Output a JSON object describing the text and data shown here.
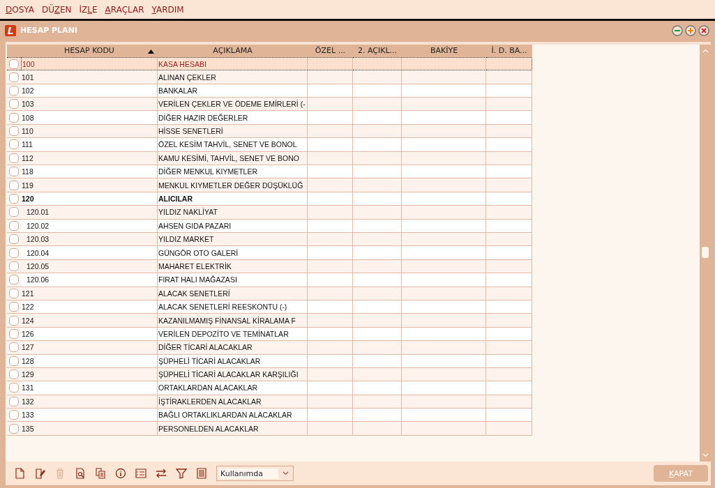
{
  "menu": [
    {
      "accel": "D",
      "after": "OSYA"
    },
    {
      "before": "DÜ",
      "accel": "Z",
      "after": "EN"
    },
    {
      "before": "İZ",
      "accel": "L",
      "after": "E"
    },
    {
      "accel": "A",
      "after": "RAÇLAR"
    },
    {
      "accel": "Y",
      "after": "ARDIM"
    }
  ],
  "window": {
    "title": "HESAP PLANI"
  },
  "table": {
    "columns": [
      {
        "label": "HESAP KODU",
        "sorted": true
      },
      {
        "label": "AÇIKLAMA",
        "sorted": false
      },
      {
        "label": "ÖZEL ...",
        "sorted": false
      },
      {
        "label": "2. AÇIKL...",
        "sorted": false
      },
      {
        "label": "BAKİYE",
        "sorted": false
      },
      {
        "label": "İ. D. BA...",
        "sorted": false
      }
    ],
    "rows": [
      {
        "code": "100",
        "description": "KASA HESABI",
        "kind": "account",
        "checked": false,
        "selected": true
      },
      {
        "code": "101",
        "description": "ALINAN ÇEKLER",
        "kind": "account",
        "checked": false,
        "selected": false
      },
      {
        "code": "102",
        "description": "BANKALAR",
        "kind": "account",
        "checked": false,
        "selected": false
      },
      {
        "code": "103",
        "description": "VERİLEN ÇEKLER VE ÖDEME EMİRLERİ (-",
        "kind": "account",
        "checked": false,
        "selected": false
      },
      {
        "code": "108",
        "description": "DİĞER HAZIR DEĞERLER",
        "kind": "account",
        "checked": false,
        "selected": false
      },
      {
        "code": "110",
        "description": "HİSSE SENETLERİ",
        "kind": "account",
        "checked": false,
        "selected": false
      },
      {
        "code": "111",
        "description": "ÖZEL KESİM TAHVİL, SENET VE BONOL",
        "kind": "account",
        "checked": false,
        "selected": false
      },
      {
        "code": "112",
        "description": "KAMU KESİMİ, TAHVİL, SENET VE BONO",
        "kind": "account",
        "checked": false,
        "selected": false
      },
      {
        "code": "118",
        "description": "DİĞER MENKUL KIYMETLER",
        "kind": "account",
        "checked": false,
        "selected": false
      },
      {
        "code": "119",
        "description": "MENKUL KIYMETLER DEĞER DÜŞÜKLÜĞ",
        "kind": "account",
        "checked": false,
        "selected": false
      },
      {
        "code": "120",
        "description": "ALICILAR",
        "kind": "group",
        "checked": false,
        "selected": false,
        "children": [
          {
            "code": "120.01",
            "description": "YILDIZ NAKLİYAT",
            "kind": "account",
            "checked": false,
            "selected": false
          },
          {
            "code": "120.02",
            "description": "AHSEN GIDA PAZARI",
            "kind": "account",
            "checked": false,
            "selected": false
          },
          {
            "code": "120.03",
            "description": "YILDIZ MARKET",
            "kind": "account",
            "checked": false,
            "selected": false
          },
          {
            "code": "120.04",
            "description": "GÜNGÖR OTO GALERİ",
            "kind": "account",
            "checked": false,
            "selected": false
          },
          {
            "code": "120.05",
            "description": "MAHARET ELEKTRİK",
            "kind": "account",
            "checked": false,
            "selected": false
          },
          {
            "code": "120.06",
            "description": "FIRAT HALI MAĞAZASI",
            "kind": "account",
            "checked": false,
            "selected": false
          }
        ]
      },
      {
        "code": "121",
        "description": "ALACAK SENETLERİ",
        "kind": "account",
        "checked": false,
        "selected": false
      },
      {
        "code": "122",
        "description": "ALACAK SENETLERİ REESKONTU (-)",
        "kind": "account",
        "checked": false,
        "selected": false
      },
      {
        "code": "124",
        "description": "KAZANILMAMIŞ FİNANSAL KİRALAMA F",
        "kind": "account",
        "checked": false,
        "selected": false
      },
      {
        "code": "126",
        "description": "VERİLEN DEPOZİTO VE TEMİNATLAR",
        "kind": "account",
        "checked": false,
        "selected": false
      },
      {
        "code": "127",
        "description": "DİĞER TİCARİ ALACAKLAR",
        "kind": "account",
        "checked": false,
        "selected": false
      },
      {
        "code": "128",
        "description": "ŞÜPHELİ TİCARİ ALACAKLAR",
        "kind": "account",
        "checked": false,
        "selected": false
      },
      {
        "code": "129",
        "description": "ŞÜPHELİ TİCARİ ALACAKLAR KARŞILIĞI",
        "kind": "account",
        "checked": false,
        "selected": false
      },
      {
        "code": "131",
        "description": "ORTAKLARDAN ALACAKLAR",
        "kind": "account",
        "checked": false,
        "selected": false
      },
      {
        "code": "132",
        "description": "İŞTİRAKLERDEN ALACAKLAR",
        "kind": "account",
        "checked": false,
        "selected": false
      },
      {
        "code": "133",
        "description": "BAĞLI ORTAKLIKLARDAN ALACAKLAR",
        "kind": "account",
        "checked": false,
        "selected": false
      },
      {
        "code": "135",
        "description": "PERSONELDEN ALACAKLAR",
        "kind": "account",
        "checked": false,
        "selected": false
      }
    ]
  },
  "toolbar": [
    {
      "kind": "new",
      "disabled": false
    },
    {
      "kind": "edit",
      "disabled": false
    },
    {
      "kind": "delete",
      "disabled": true
    },
    {
      "kind": "preview",
      "disabled": false
    },
    {
      "kind": "copy",
      "disabled": false
    },
    {
      "kind": "info",
      "disabled": false
    },
    {
      "kind": "list",
      "disabled": false
    },
    {
      "kind": "swap",
      "disabled": false
    },
    {
      "kind": "filter",
      "disabled": false
    },
    {
      "kind": "report",
      "disabled": false
    }
  ],
  "filter": {
    "value": "Kullanımda"
  },
  "close_button": {
    "accel": "K",
    "after": "APAT"
  }
}
